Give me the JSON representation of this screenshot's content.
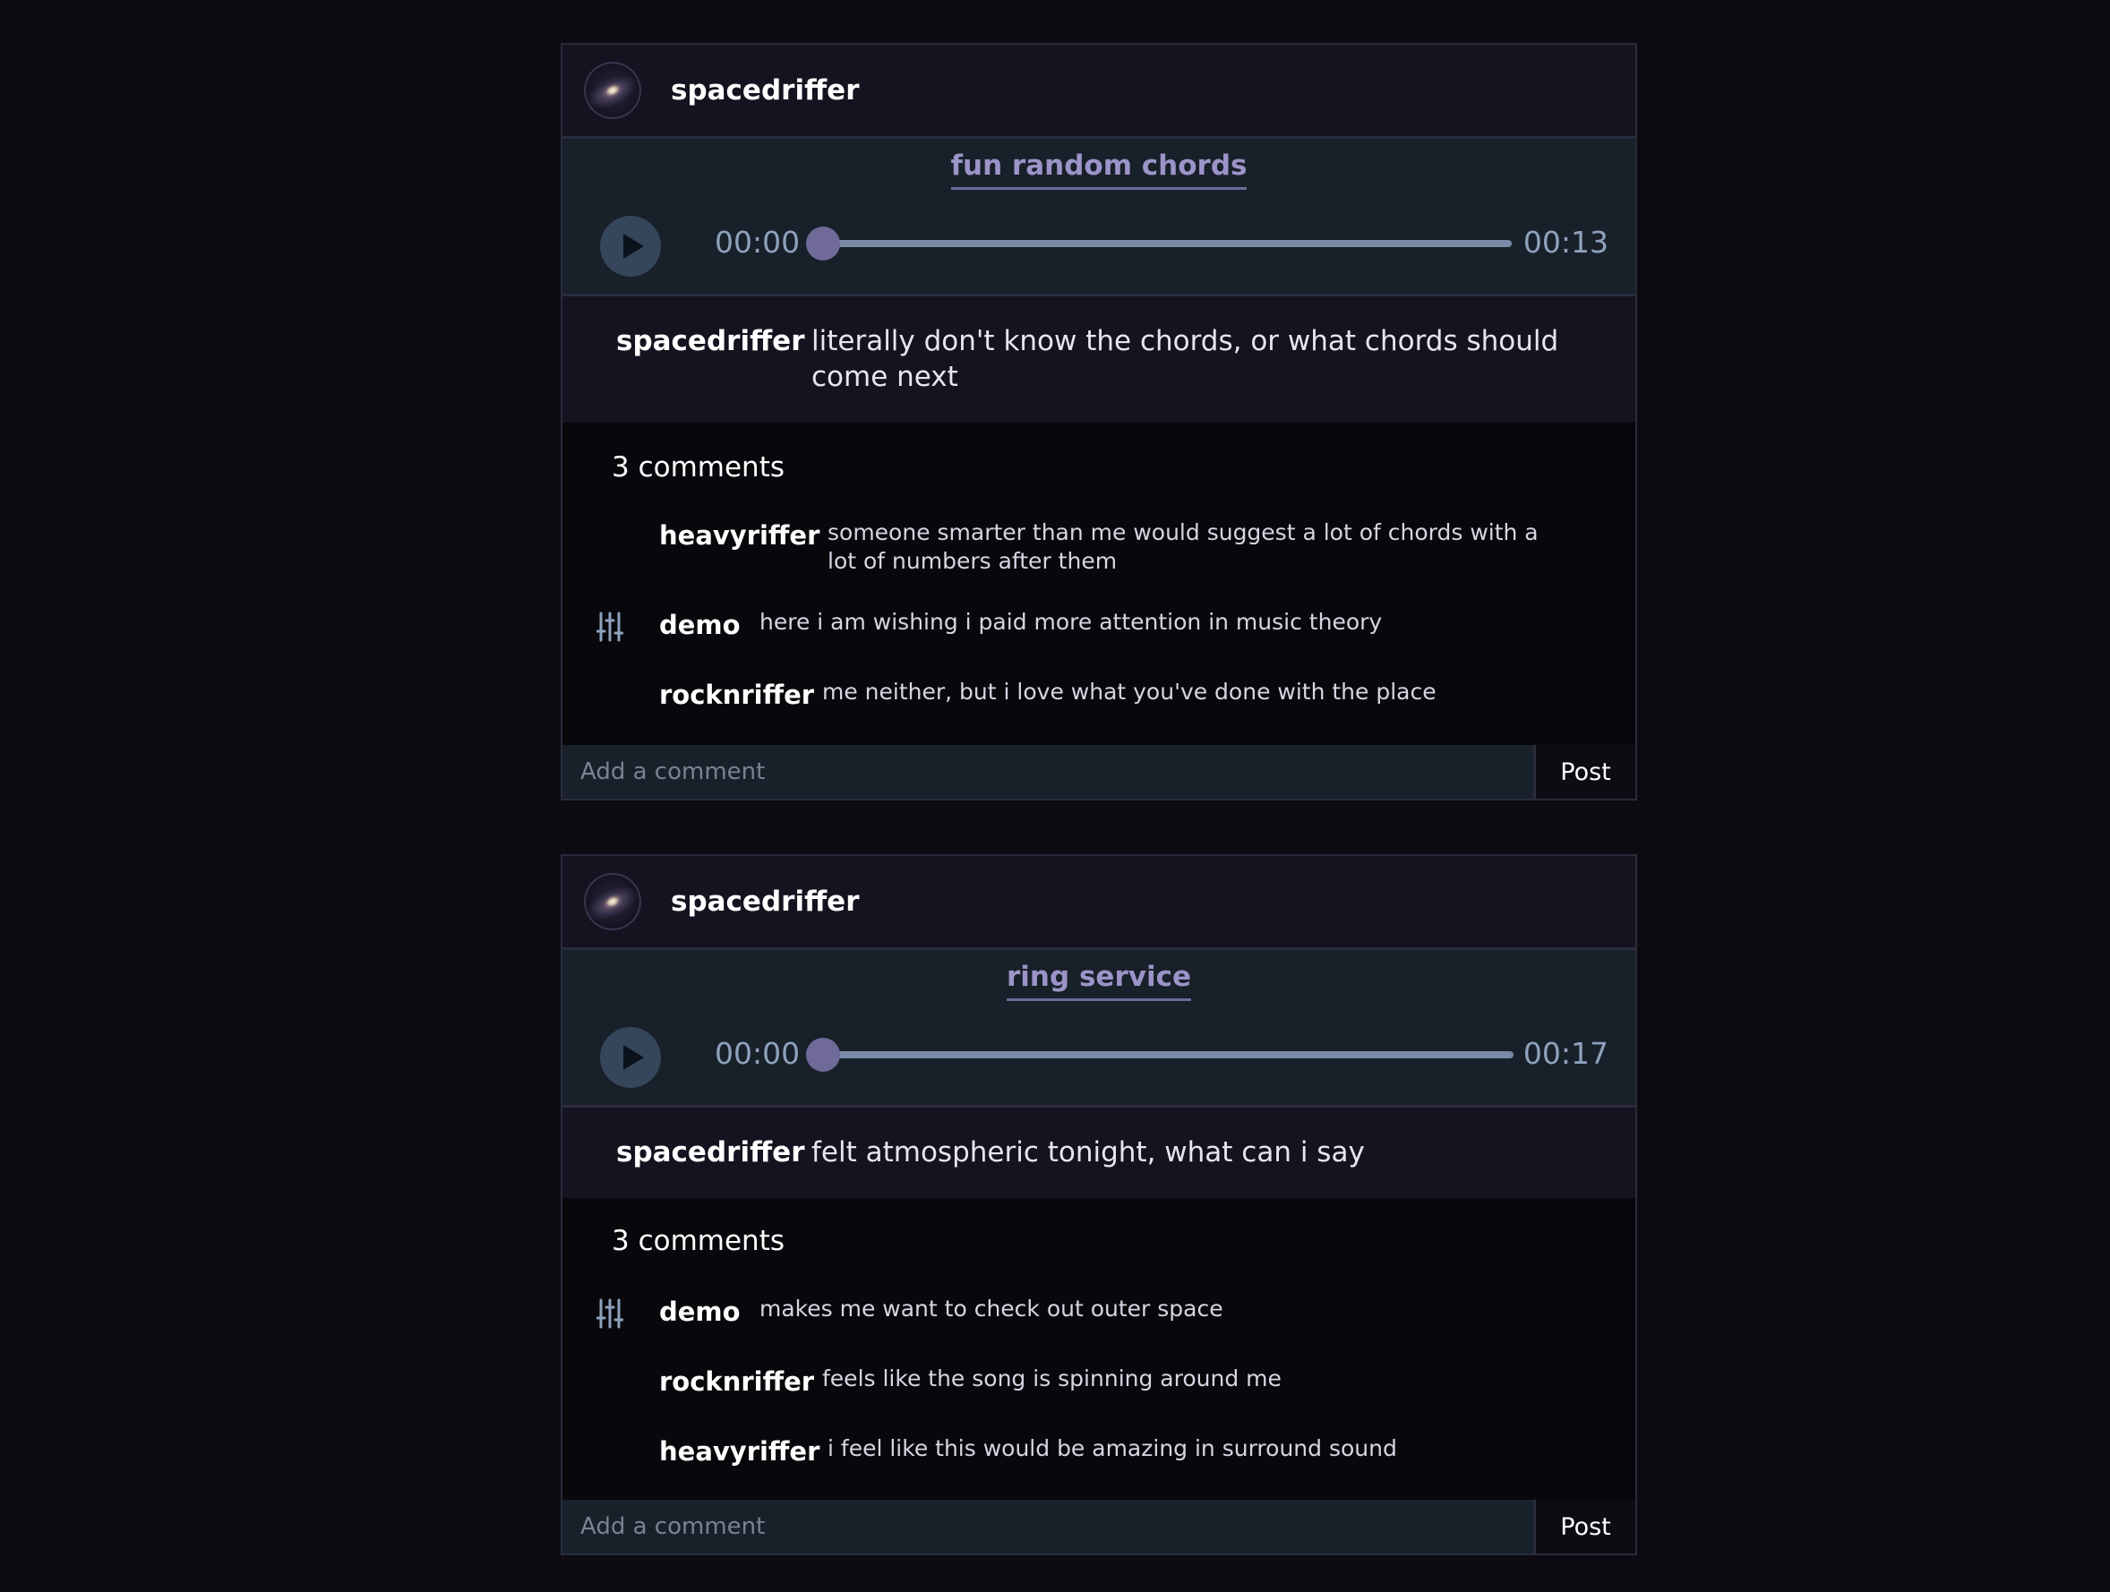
{
  "posts": [
    {
      "author": "spacedriffer",
      "track": {
        "title": "fun random chords",
        "current_time": "00:00",
        "duration": "00:13",
        "progress": 0
      },
      "caption": {
        "user": "spacedriffer",
        "text": "literally don't know the chords, or what chords should come next"
      },
      "comments_count": "3 comments",
      "comments": [
        {
          "user": "heavyriffer",
          "text": "someone smarter than me would suggest a lot of chords with a lot of numbers after them",
          "icon": null
        },
        {
          "user": "demo",
          "text": "here i am wishing i paid more attention in music theory",
          "icon": "mixer-sliders-icon"
        },
        {
          "user": "rocknriffer",
          "text": "me neither, but i love what you've done with the place",
          "icon": null
        }
      ],
      "add_comment": {
        "placeholder": "Add a comment",
        "button": "Post"
      }
    },
    {
      "author": "spacedriffer",
      "track": {
        "title": "ring service",
        "current_time": "00:00",
        "duration": "00:17",
        "progress": 0
      },
      "caption": {
        "user": "spacedriffer",
        "text": "felt atmospheric tonight, what can i say"
      },
      "comments_count": "3 comments",
      "comments": [
        {
          "user": "demo",
          "text": "makes me want to check out outer space",
          "icon": "mixer-sliders-icon"
        },
        {
          "user": "rocknriffer",
          "text": "feels like the song is spinning around me",
          "icon": null
        },
        {
          "user": "heavyriffer",
          "text": "i feel like this would be amazing in surround sound",
          "icon": null
        }
      ],
      "add_comment": {
        "placeholder": "Add a comment",
        "button": "Post"
      }
    }
  ],
  "colors": {
    "background": "#0c0b12",
    "header": "#15131f",
    "player": "#18202a",
    "accent": "#9c94c8",
    "slider_thumb": "#6f6a98"
  }
}
